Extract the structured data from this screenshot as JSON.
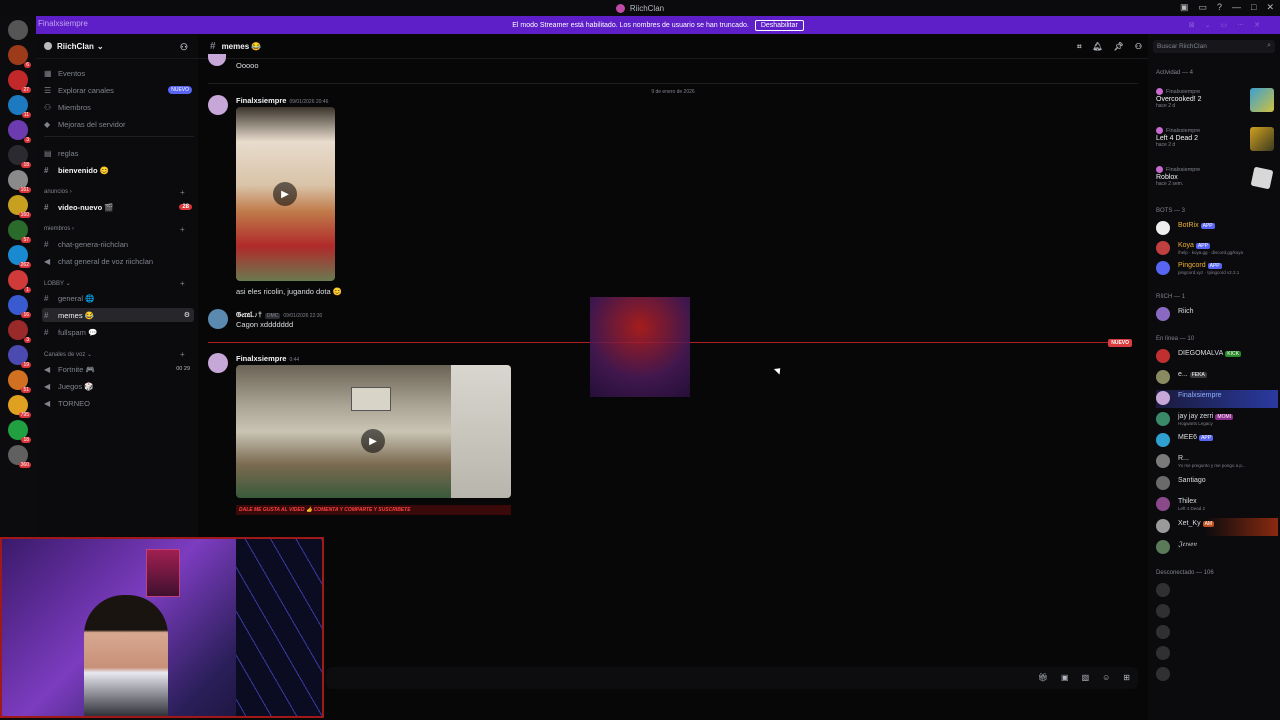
{
  "window": {
    "title": "RiichClan"
  },
  "streamer_banner": {
    "username_ghost": "Finalxsiempre",
    "message": "El modo Streamer está habilitado. Los nombres de usuario se han truncado.",
    "button": "Deshabilitar"
  },
  "server_rail": {
    "badges": [
      "6",
      "27",
      "11",
      "3",
      "18",
      "161",
      "160",
      "57",
      "262",
      "1",
      "16",
      "3",
      "19",
      "51",
      "795",
      "18",
      "360"
    ]
  },
  "sidebar": {
    "guild_name": "RiichClan",
    "items": [
      {
        "label": "Eventos"
      },
      {
        "label": "Explorar canales",
        "tag": "NUEVO"
      },
      {
        "label": "Miembros"
      },
      {
        "label": "Mejoras del servidor"
      },
      {
        "label": "reglas"
      },
      {
        "label": "bienvenido 😊"
      },
      {
        "label": "video-nuevo 🎬",
        "badge": "28"
      },
      {
        "label": "chat-genera-riichclan"
      },
      {
        "label": "chat general de voz riichclan"
      },
      {
        "label": "general 🌐"
      },
      {
        "label": "memes 😂"
      },
      {
        "label": "fullspam 💬"
      },
      {
        "label": "Fortnite 🎮",
        "counts": "00 29"
      },
      {
        "label": "Juegos 🎲"
      },
      {
        "label": "TORNEO"
      }
    ],
    "categories": [
      "anuncios",
      "miembros",
      "LOBBY",
      "Canales de voz"
    ]
  },
  "channel": {
    "name": "memes 😂"
  },
  "messages": {
    "first_text": "Ooooo",
    "date_divider": "9 de enero de 2026",
    "m1": {
      "author": "Finalxsiempre",
      "time": "09/01/2026 20:46",
      "caption": "asi eles ricolin, jugando dota 😊"
    },
    "m2": {
      "author": "𝔊𝔢𝔯𝔞𝔩.♪†",
      "tag": "DMC",
      "time": "09/01/2026 22:30",
      "text": "Cagon xddddddd"
    },
    "new_label": "NUEVO",
    "m3": {
      "author": "Finalxsiempre",
      "time": "0:44",
      "banner": "DALE ME GUSTA AL VIDEO 👍 COMENTA Y COMPARTE Y SUSCRIBETE"
    }
  },
  "members": {
    "search_placeholder": "Buscar RiichClan",
    "activity_header": "Actividad — 4",
    "activity": [
      {
        "who": "Finalxsiempre",
        "game": "Overcooked! 2",
        "ago": "hace 2 d"
      },
      {
        "who": "Finalxsiempre",
        "game": "Left 4 Dead 2",
        "ago": "hace 2 d"
      },
      {
        "who": "Finalxsiempre",
        "game": "Roblox",
        "ago": "hace 2 sem."
      }
    ],
    "bots_header": "BOTS — 3",
    "bots": [
      {
        "name": "BotRix",
        "tag": "APP",
        "sub": ""
      },
      {
        "name": "Koya",
        "tag": "APP",
        "sub": "/help · koya.gg · discord.gg/koya"
      },
      {
        "name": "Pingcord",
        "tag": "APP",
        "sub": "pingcord.xyz · !pingcord v2.2.1"
      }
    ],
    "riich_header": "RIICH — 1",
    "riich": [
      {
        "name": "Riich"
      }
    ],
    "online_header": "En línea — 10",
    "online": [
      {
        "name": "DIEGOMALVA",
        "tag": "KICK",
        "sub": ""
      },
      {
        "name": "e...",
        "tag": "FEKA",
        "sub": ""
      },
      {
        "name": "Finalxsiempre",
        "tag": "",
        "sub": ""
      },
      {
        "name": "jay jay zerri",
        "tag": "MOMI",
        "sub": "Hogwarts Legacy"
      },
      {
        "name": "MEE6",
        "tag": "APP",
        "sub": ""
      },
      {
        "name": "R...",
        "tag": "",
        "sub": "Yo me pregunto y me pongo a p..."
      },
      {
        "name": "Santiago",
        "tag": "",
        "sub": ""
      },
      {
        "name": "Thilex",
        "tag": "",
        "sub": "Left 4 Dead 2"
      },
      {
        "name": "Xet_Ky",
        "tag": "AM",
        "sub": ""
      },
      {
        "name": "𝔍𝔢𝔯𝔰𝔬𝔫",
        "tag": "",
        "sub": ""
      }
    ],
    "offline_header": "Desconectado — 106"
  }
}
